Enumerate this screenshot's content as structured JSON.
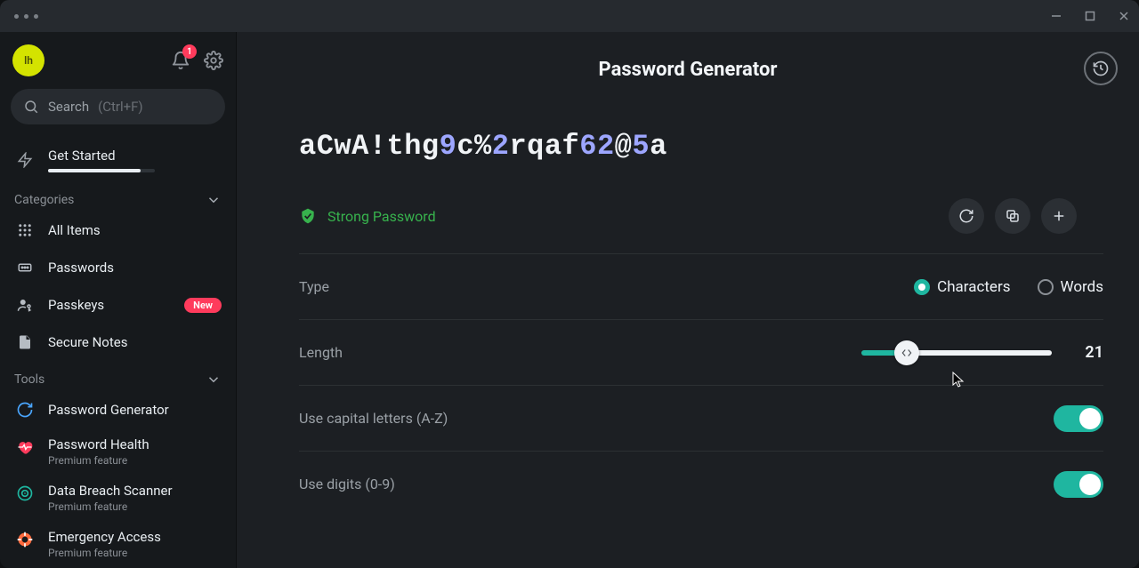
{
  "titlebar": {},
  "sidebar": {
    "avatar_initials": "lh",
    "notifications_count": "1",
    "search": {
      "label": "Search",
      "shortcut": "(Ctrl+F)"
    },
    "get_started": "Get Started",
    "categories_header": "Categories",
    "categories": [
      {
        "label": "All Items"
      },
      {
        "label": "Passwords"
      },
      {
        "label": "Passkeys",
        "badge": "New"
      },
      {
        "label": "Secure Notes"
      }
    ],
    "tools_header": "Tools",
    "tools": [
      {
        "label": "Password Generator"
      },
      {
        "label": "Password Health",
        "sub": "Premium feature"
      },
      {
        "label": "Data Breach Scanner",
        "sub": "Premium feature"
      },
      {
        "label": "Emergency Access",
        "sub": "Premium feature"
      }
    ]
  },
  "main": {
    "title": "Password Generator",
    "password_segments": [
      {
        "t": "aCwA!thg",
        "cls": "t"
      },
      {
        "t": "9",
        "cls": "n"
      },
      {
        "t": "c%",
        "cls": "t"
      },
      {
        "t": "2",
        "cls": "n"
      },
      {
        "t": "rqaf",
        "cls": "t"
      },
      {
        "t": "62",
        "cls": "n"
      },
      {
        "t": "@",
        "cls": "t"
      },
      {
        "t": "5",
        "cls": "n"
      },
      {
        "t": "a",
        "cls": "t"
      }
    ],
    "strength_label": "Strong Password",
    "type_label": "Type",
    "type_options": {
      "characters": "Characters",
      "words": "Words"
    },
    "type_selected": "characters",
    "length_label": "Length",
    "length_value": "21",
    "capitals_label": "Use capital letters (A-Z)",
    "digits_label": "Use digits (0-9)"
  }
}
